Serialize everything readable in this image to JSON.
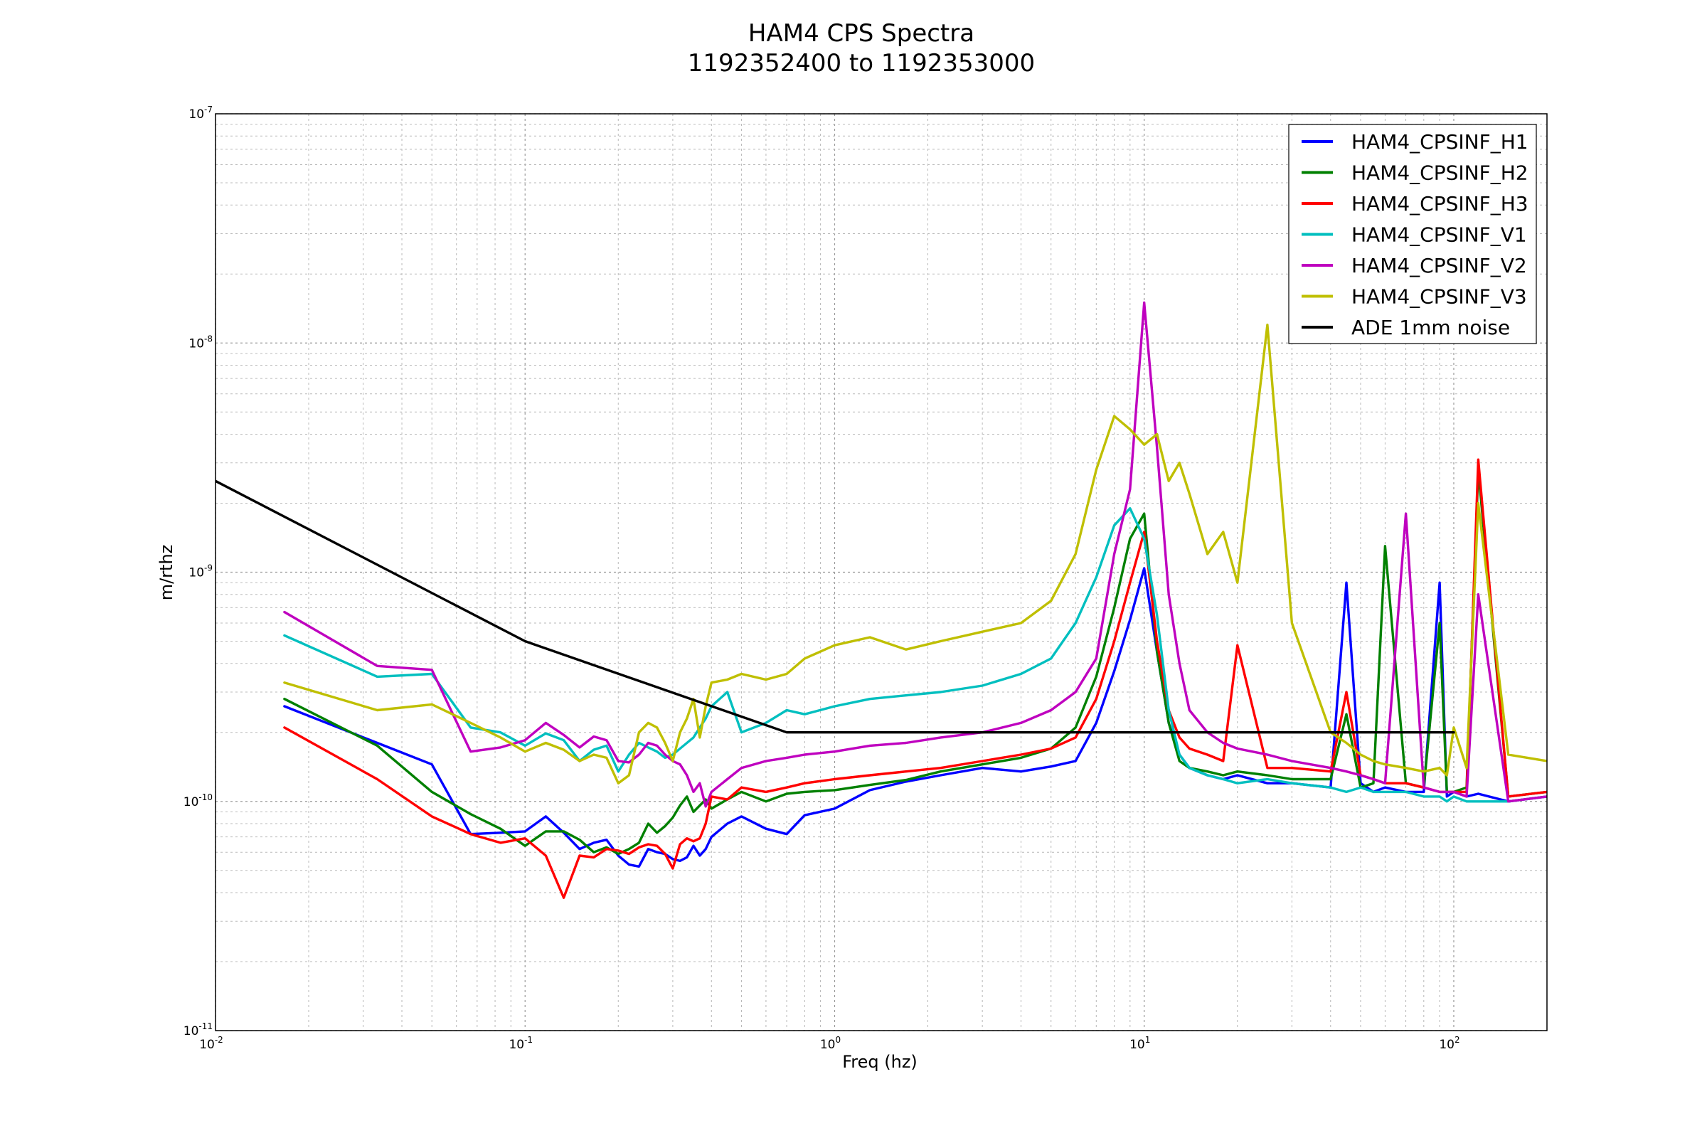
{
  "chart_data": {
    "type": "line",
    "title": "HAM4 CPS Spectra",
    "subtitle": "1192352400 to 1192353000",
    "xlabel": "Freq (hz)",
    "ylabel": "m/rthz",
    "xscale": "log",
    "yscale": "log",
    "xlim": [
      0.01,
      200
    ],
    "ylim": [
      1e-11,
      1e-07
    ],
    "grid": true,
    "legend_position": "top-right",
    "x_ticks": [
      {
        "base": "10",
        "exp": "-2",
        "value": 0.01
      },
      {
        "base": "10",
        "exp": "-1",
        "value": 0.1
      },
      {
        "base": "10",
        "exp": "0",
        "value": 1
      },
      {
        "base": "10",
        "exp": "1",
        "value": 10
      },
      {
        "base": "10",
        "exp": "2",
        "value": 100
      }
    ],
    "y_ticks": [
      {
        "base": "10",
        "exp": "-11",
        "value": 1e-11
      },
      {
        "base": "10",
        "exp": "-10",
        "value": 1e-10
      },
      {
        "base": "10",
        "exp": "-9",
        "value": 1e-09
      },
      {
        "base": "10",
        "exp": "-8",
        "value": 1e-08
      },
      {
        "base": "10",
        "exp": "-7",
        "value": 1e-07
      }
    ],
    "series": [
      {
        "name": "HAM4_CPSINF_H1",
        "color": "#0000ff",
        "x": [
          0.0167,
          0.0333,
          0.05,
          0.0667,
          0.0833,
          0.1,
          0.1167,
          0.1333,
          0.15,
          0.1667,
          0.1833,
          0.2,
          0.2167,
          0.2333,
          0.25,
          0.2667,
          0.2833,
          0.3,
          0.3167,
          0.3333,
          0.35,
          0.3667,
          0.3833,
          0.4,
          0.45,
          0.5,
          0.6,
          0.7,
          0.8,
          1,
          1.3,
          1.7,
          2.2,
          3,
          4,
          5,
          6,
          7,
          8,
          9,
          10,
          11,
          12,
          13,
          14,
          16,
          18,
          20,
          25,
          30,
          40,
          45,
          50,
          55,
          60,
          70,
          80,
          90,
          95,
          100,
          110,
          120,
          150,
          200
        ],
        "y": [
          2.6e-10,
          1.8e-10,
          1.45e-10,
          7.2e-11,
          7.3e-11,
          7.4e-11,
          8.6e-11,
          7.3e-11,
          6.2e-11,
          6.6e-11,
          6.8e-11,
          5.8e-11,
          5.3e-11,
          5.2e-11,
          6.2e-11,
          6e-11,
          5.9e-11,
          5.6e-11,
          5.5e-11,
          5.7e-11,
          6.4e-11,
          5.8e-11,
          6.2e-11,
          7e-11,
          8e-11,
          8.6e-11,
          7.6e-11,
          7.2e-11,
          8.7e-11,
          9.3e-11,
          1.12e-10,
          1.22e-10,
          1.3e-10,
          1.4e-10,
          1.35e-10,
          1.42e-10,
          1.5e-10,
          2.2e-10,
          3.7e-10,
          6.2e-10,
          1.04e-09,
          4.5e-10,
          2.2e-10,
          1.6e-10,
          1.4e-10,
          1.3e-10,
          1.25e-10,
          1.3e-10,
          1.2e-10,
          1.2e-10,
          1.15e-10,
          9e-10,
          1.2e-10,
          1.1e-10,
          1.15e-10,
          1.1e-10,
          1.1e-10,
          9e-10,
          1.05e-10,
          1.1e-10,
          1.05e-10,
          1.08e-10,
          1e-10,
          1.05e-10
        ]
      },
      {
        "name": "HAM4_CPSINF_H2",
        "color": "#008000",
        "x": [
          0.0167,
          0.0333,
          0.05,
          0.0667,
          0.0833,
          0.1,
          0.1167,
          0.1333,
          0.15,
          0.1667,
          0.1833,
          0.2,
          0.2167,
          0.2333,
          0.25,
          0.2667,
          0.2833,
          0.3,
          0.3167,
          0.3333,
          0.35,
          0.3667,
          0.3833,
          0.4,
          0.45,
          0.5,
          0.6,
          0.7,
          0.8,
          1,
          1.3,
          1.7,
          2.2,
          3,
          4,
          5,
          6,
          7,
          8,
          9,
          10,
          11,
          12,
          13,
          14,
          16,
          18,
          20,
          25,
          30,
          40,
          45,
          50,
          55,
          60,
          70,
          80,
          90,
          95,
          100,
          110,
          120,
          150,
          200
        ],
        "y": [
          2.8e-10,
          1.75e-10,
          1.1e-10,
          8.8e-11,
          7.6e-11,
          6.4e-11,
          7.4e-11,
          7.4e-11,
          6.8e-11,
          6e-11,
          6.3e-11,
          5.9e-11,
          6.2e-11,
          6.6e-11,
          8e-11,
          7.3e-11,
          7.8e-11,
          8.5e-11,
          9.6e-11,
          1.05e-10,
          9e-11,
          9.6e-11,
          1.02e-10,
          9.3e-11,
          1.02e-10,
          1.1e-10,
          1e-10,
          1.08e-10,
          1.1e-10,
          1.12e-10,
          1.18e-10,
          1.24e-10,
          1.35e-10,
          1.45e-10,
          1.55e-10,
          1.7e-10,
          2.1e-10,
          3.5e-10,
          7e-10,
          1.4e-09,
          1.8e-09,
          4.5e-10,
          2.2e-10,
          1.5e-10,
          1.4e-10,
          1.35e-10,
          1.3e-10,
          1.35e-10,
          1.3e-10,
          1.25e-10,
          1.25e-10,
          2.4e-10,
          1.15e-10,
          1.2e-10,
          1.3e-09,
          1.2e-10,
          1.15e-10,
          6e-10,
          1.1e-10,
          1.1e-10,
          1.15e-10,
          2.8e-09,
          1.05e-10,
          1.1e-10
        ]
      },
      {
        "name": "HAM4_CPSINF_H3",
        "color": "#ff0000",
        "x": [
          0.0167,
          0.0333,
          0.05,
          0.0667,
          0.0833,
          0.1,
          0.1167,
          0.1333,
          0.15,
          0.1667,
          0.1833,
          0.2,
          0.2167,
          0.2333,
          0.25,
          0.2667,
          0.2833,
          0.3,
          0.3167,
          0.3333,
          0.35,
          0.3667,
          0.3833,
          0.4,
          0.45,
          0.5,
          0.6,
          0.7,
          0.8,
          1,
          1.3,
          1.7,
          2.2,
          3,
          4,
          5,
          6,
          7,
          8,
          9,
          10,
          11,
          12,
          13,
          14,
          16,
          18,
          20,
          25,
          30,
          40,
          45,
          50,
          55,
          60,
          70,
          80,
          90,
          95,
          100,
          110,
          120,
          150,
          200
        ],
        "y": [
          2.1e-10,
          1.25e-10,
          8.6e-11,
          7.2e-11,
          6.6e-11,
          6.9e-11,
          5.8e-11,
          3.8e-11,
          5.8e-11,
          5.7e-11,
          6.2e-11,
          6.1e-11,
          5.9e-11,
          6.3e-11,
          6.5e-11,
          6.4e-11,
          5.9e-11,
          5.1e-11,
          6.5e-11,
          6.9e-11,
          6.7e-11,
          6.9e-11,
          8e-11,
          1.05e-10,
          1.02e-10,
          1.15e-10,
          1.1e-10,
          1.15e-10,
          1.2e-10,
          1.25e-10,
          1.3e-10,
          1.35e-10,
          1.4e-10,
          1.5e-10,
          1.6e-10,
          1.7e-10,
          1.9e-10,
          2.8e-10,
          5e-10,
          9e-10,
          1.5e-09,
          5e-10,
          2.5e-10,
          1.9e-10,
          1.7e-10,
          1.6e-10,
          1.5e-10,
          4.8e-10,
          1.4e-10,
          1.4e-10,
          1.35e-10,
          3e-10,
          1.3e-10,
          1.25e-10,
          1.2e-10,
          1.2e-10,
          1.15e-10,
          1.1e-10,
          1.1e-10,
          1.1e-10,
          1.1e-10,
          3.1e-09,
          1.05e-10,
          1.1e-10
        ]
      },
      {
        "name": "HAM4_CPSINF_V1",
        "color": "#00bfbf",
        "x": [
          0.0167,
          0.0333,
          0.05,
          0.0667,
          0.0833,
          0.1,
          0.1167,
          0.1333,
          0.15,
          0.1667,
          0.1833,
          0.2,
          0.2167,
          0.2333,
          0.25,
          0.2667,
          0.2833,
          0.3,
          0.3167,
          0.3333,
          0.35,
          0.3667,
          0.3833,
          0.4,
          0.45,
          0.5,
          0.6,
          0.7,
          0.8,
          1,
          1.3,
          1.7,
          2.2,
          3,
          4,
          5,
          6,
          7,
          8,
          9,
          10,
          11,
          12,
          13,
          14,
          16,
          18,
          20,
          25,
          30,
          40,
          45,
          50,
          55,
          60,
          70,
          80,
          90,
          95,
          100,
          110,
          120,
          150,
          200
        ],
        "y": [
          5.3e-10,
          3.5e-10,
          3.6e-10,
          2.1e-10,
          2e-10,
          1.75e-10,
          1.98e-10,
          1.85e-10,
          1.5e-10,
          1.68e-10,
          1.75e-10,
          1.35e-10,
          1.6e-10,
          1.8e-10,
          1.72e-10,
          1.65e-10,
          1.55e-10,
          1.6e-10,
          1.7e-10,
          1.8e-10,
          1.9e-10,
          2.1e-10,
          2.3e-10,
          2.6e-10,
          3e-10,
          2e-10,
          2.2e-10,
          2.5e-10,
          2.4e-10,
          2.6e-10,
          2.8e-10,
          2.9e-10,
          3e-10,
          3.2e-10,
          3.6e-10,
          4.2e-10,
          6e-10,
          9.5e-10,
          1.6e-09,
          1.9e-09,
          1.4e-09,
          6.5e-10,
          2.5e-10,
          1.6e-10,
          1.4e-10,
          1.3e-10,
          1.25e-10,
          1.2e-10,
          1.25e-10,
          1.2e-10,
          1.15e-10,
          1.1e-10,
          1.15e-10,
          1.1e-10,
          1.1e-10,
          1.1e-10,
          1.05e-10,
          1.05e-10,
          1e-10,
          1.05e-10,
          1e-10,
          1e-10,
          1e-10,
          1.05e-10
        ]
      },
      {
        "name": "HAM4_CPSINF_V2",
        "color": "#bf00bf",
        "x": [
          0.0167,
          0.0333,
          0.05,
          0.0667,
          0.0833,
          0.1,
          0.1167,
          0.1333,
          0.15,
          0.1667,
          0.1833,
          0.2,
          0.2167,
          0.2333,
          0.25,
          0.2667,
          0.2833,
          0.3,
          0.3167,
          0.3333,
          0.35,
          0.3667,
          0.3833,
          0.4,
          0.45,
          0.5,
          0.6,
          0.7,
          0.8,
          1,
          1.3,
          1.7,
          2.2,
          3,
          4,
          5,
          6,
          7,
          8,
          9,
          10,
          11,
          12,
          13,
          14,
          16,
          18,
          20,
          25,
          30,
          40,
          45,
          50,
          55,
          60,
          70,
          80,
          90,
          95,
          100,
          110,
          120,
          150,
          200
        ],
        "y": [
          6.7e-10,
          3.9e-10,
          3.75e-10,
          1.65e-10,
          1.72e-10,
          1.85e-10,
          2.2e-10,
          1.95e-10,
          1.72e-10,
          1.92e-10,
          1.85e-10,
          1.5e-10,
          1.48e-10,
          1.6e-10,
          1.8e-10,
          1.75e-10,
          1.6e-10,
          1.5e-10,
          1.45e-10,
          1.3e-10,
          1.1e-10,
          1.2e-10,
          9.5e-11,
          1.1e-10,
          1.25e-10,
          1.4e-10,
          1.5e-10,
          1.55e-10,
          1.6e-10,
          1.65e-10,
          1.75e-10,
          1.8e-10,
          1.9e-10,
          2e-10,
          2.2e-10,
          2.5e-10,
          3e-10,
          4.2e-10,
          1.2e-09,
          2.3e-09,
          1.5e-08,
          3.5e-09,
          8e-10,
          4e-10,
          2.5e-10,
          2e-10,
          1.8e-10,
          1.7e-10,
          1.6e-10,
          1.5e-10,
          1.4e-10,
          1.35e-10,
          1.3e-10,
          1.25e-10,
          1.2e-10,
          1.8e-09,
          1.15e-10,
          1.1e-10,
          1.1e-10,
          1.1e-10,
          1.05e-10,
          8e-10,
          1e-10,
          1.05e-10
        ]
      },
      {
        "name": "HAM4_CPSINF_V3",
        "color": "#bfbf00",
        "x": [
          0.0167,
          0.0333,
          0.05,
          0.0667,
          0.0833,
          0.1,
          0.1167,
          0.1333,
          0.15,
          0.1667,
          0.1833,
          0.2,
          0.2167,
          0.2333,
          0.25,
          0.2667,
          0.2833,
          0.3,
          0.3167,
          0.3333,
          0.35,
          0.3667,
          0.3833,
          0.4,
          0.45,
          0.5,
          0.6,
          0.7,
          0.8,
          1,
          1.3,
          1.7,
          2.2,
          3,
          4,
          5,
          6,
          7,
          8,
          9,
          10,
          11,
          12,
          13,
          14,
          16,
          18,
          20,
          25,
          30,
          40,
          45,
          50,
          55,
          60,
          70,
          80,
          90,
          95,
          100,
          110,
          120,
          150,
          200
        ],
        "y": [
          3.3e-10,
          2.5e-10,
          2.65e-10,
          2.2e-10,
          1.9e-10,
          1.65e-10,
          1.8e-10,
          1.68e-10,
          1.5e-10,
          1.6e-10,
          1.55e-10,
          1.2e-10,
          1.3e-10,
          2e-10,
          2.2e-10,
          2.1e-10,
          1.8e-10,
          1.5e-10,
          2e-10,
          2.3e-10,
          2.8e-10,
          1.9e-10,
          2.6e-10,
          3.3e-10,
          3.4e-10,
          3.6e-10,
          3.4e-10,
          3.6e-10,
          4.2e-10,
          4.8e-10,
          5.2e-10,
          4.6e-10,
          5e-10,
          5.5e-10,
          6e-10,
          7.5e-10,
          1.2e-09,
          2.8e-09,
          4.8e-09,
          4.2e-09,
          3.6e-09,
          4e-09,
          2.5e-09,
          3e-09,
          2.2e-09,
          1.2e-09,
          1.5e-09,
          9e-10,
          1.2e-08,
          6e-10,
          2e-10,
          1.8e-10,
          1.6e-10,
          1.5e-10,
          1.45e-10,
          1.4e-10,
          1.35e-10,
          1.4e-10,
          1.3e-10,
          2.1e-10,
          1.4e-10,
          2e-09,
          1.6e-10,
          1.5e-10
        ]
      },
      {
        "name": "ADE 1mm noise",
        "color": "#000000",
        "x": [
          0.01,
          0.1,
          0.7,
          100
        ],
        "y": [
          2.5e-09,
          5e-10,
          2e-10,
          2e-10
        ]
      }
    ]
  }
}
